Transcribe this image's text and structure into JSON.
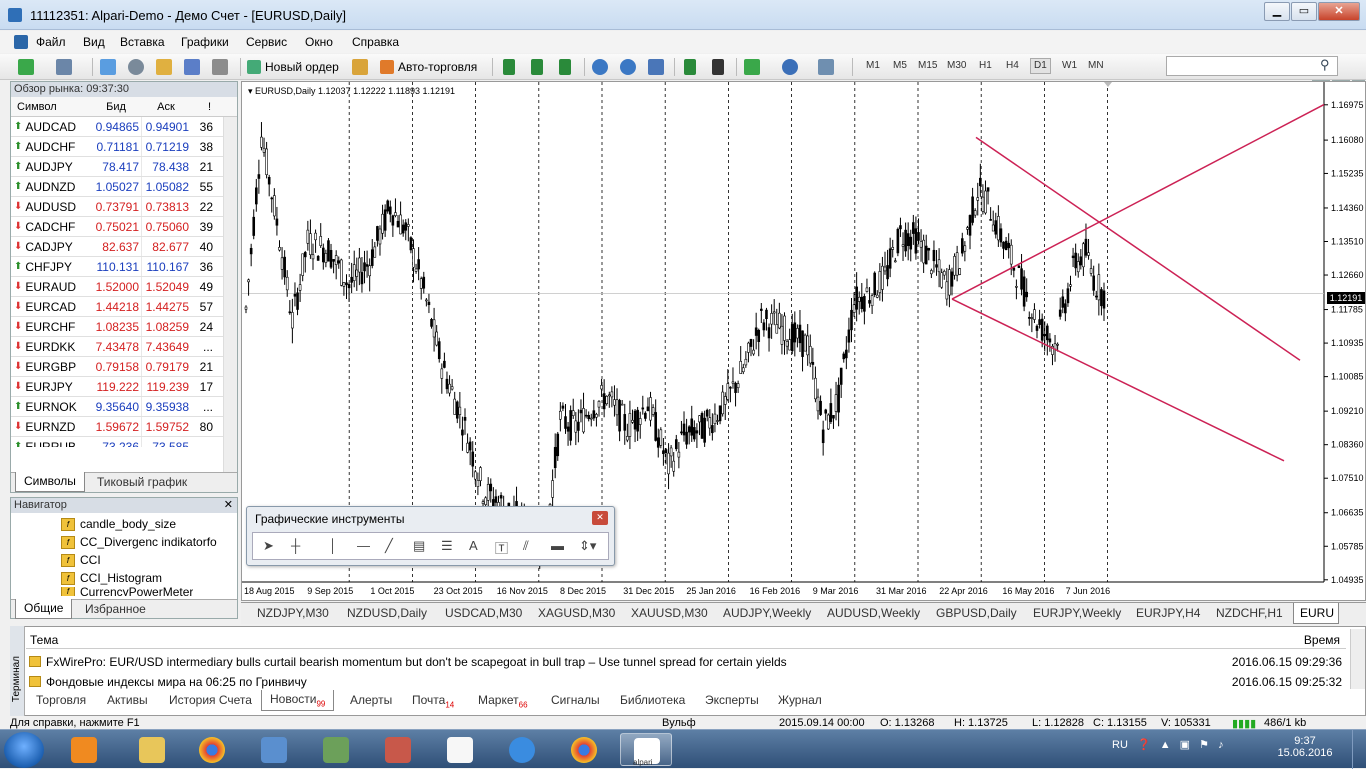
{
  "window": {
    "title": "11112351: Alpari-Demo - Демо Счет - [EURUSD,Daily]"
  },
  "menu": [
    "Файл",
    "Вид",
    "Вставка",
    "Графики",
    "Сервис",
    "Окно",
    "Справка"
  ],
  "toolbar": {
    "new_order": "Новый ордер",
    "autotrading": "Авто-торговля",
    "timeframes": [
      "M1",
      "M5",
      "M15",
      "M30",
      "H1",
      "H4",
      "D1",
      "W1",
      "MN"
    ],
    "active_timeframe": "D1"
  },
  "market_watch": {
    "header": "Обзор рынка: 09:37:30",
    "columns": [
      "Символ",
      "Бид",
      "Аск",
      "!"
    ],
    "rows": [
      {
        "symbol": "AUDCAD",
        "bid": "0.94865",
        "ask": "0.94901",
        "spread": "36",
        "dir": "up"
      },
      {
        "symbol": "AUDCHF",
        "bid": "0.71181",
        "ask": "0.71219",
        "spread": "38",
        "dir": "up"
      },
      {
        "symbol": "AUDJPY",
        "bid": "78.417",
        "ask": "78.438",
        "spread": "21",
        "dir": "up"
      },
      {
        "symbol": "AUDNZD",
        "bid": "1.05027",
        "ask": "1.05082",
        "spread": "55",
        "dir": "up"
      },
      {
        "symbol": "AUDUSD",
        "bid": "0.73791",
        "ask": "0.73813",
        "spread": "22",
        "dir": "down"
      },
      {
        "symbol": "CADCHF",
        "bid": "0.75021",
        "ask": "0.75060",
        "spread": "39",
        "dir": "down"
      },
      {
        "symbol": "CADJPY",
        "bid": "82.637",
        "ask": "82.677",
        "spread": "40",
        "dir": "down"
      },
      {
        "symbol": "CHFJPY",
        "bid": "110.131",
        "ask": "110.167",
        "spread": "36",
        "dir": "up"
      },
      {
        "symbol": "EURAUD",
        "bid": "1.52000",
        "ask": "1.52049",
        "spread": "49",
        "dir": "down"
      },
      {
        "symbol": "EURCAD",
        "bid": "1.44218",
        "ask": "1.44275",
        "spread": "57",
        "dir": "down"
      },
      {
        "symbol": "EURCHF",
        "bid": "1.08235",
        "ask": "1.08259",
        "spread": "24",
        "dir": "down"
      },
      {
        "symbol": "EURDKK",
        "bid": "7.43478",
        "ask": "7.43649",
        "spread": "...",
        "dir": "down"
      },
      {
        "symbol": "EURGBP",
        "bid": "0.79158",
        "ask": "0.79179",
        "spread": "21",
        "dir": "down"
      },
      {
        "symbol": "EURJPY",
        "bid": "119.222",
        "ask": "119.239",
        "spread": "17",
        "dir": "down"
      },
      {
        "symbol": "EURNOK",
        "bid": "9.35640",
        "ask": "9.35938",
        "spread": "...",
        "dir": "up"
      },
      {
        "symbol": "EURNZD",
        "bid": "1.59672",
        "ask": "1.59752",
        "spread": "80",
        "dir": "down"
      },
      {
        "symbol": "EURRUB",
        "bid": "73.236",
        "ask": "73.585",
        "spread": "...",
        "dir": "up"
      }
    ],
    "tabs": [
      "Символы",
      "Тиковый график"
    ]
  },
  "navigator": {
    "header": "Навигатор",
    "items": [
      "candle_body_size",
      "CC_Divergenc indikatorfo",
      "CCI",
      "CCI_Histogram",
      "CurrencyPowerMeter"
    ],
    "tabs": [
      "Общие",
      "Избранное"
    ]
  },
  "chart": {
    "info": "EURUSD,Daily  1.12037 1.12222 1.11893 1.12191",
    "current_price": "1.12191"
  },
  "chart_data": {
    "type": "candlestick",
    "symbol": "EURUSD",
    "timeframe": "Daily",
    "ohlc_last": [
      1.12037,
      1.12222,
      1.11893,
      1.12191
    ],
    "y_ticks": [
      "1.16975",
      "1.16080",
      "1.15235",
      "1.14360",
      "1.13510",
      "1.12660",
      "1.11785",
      "1.10935",
      "1.10085",
      "1.09210",
      "1.08360",
      "1.07510",
      "1.06635",
      "1.05785",
      "1.04935"
    ],
    "x_ticks": [
      "18 Aug 2015",
      "9 Sep 2015",
      "1 Oct 2015",
      "23 Oct 2015",
      "16 Nov 2015",
      "8 Dec 2015",
      "31 Dec 2015",
      "25 Jan 2016",
      "16 Feb 2016",
      "9 Mar 2016",
      "31 Mar 2016",
      "22 Apr 2016",
      "16 May 2016",
      "7 Jun 2016"
    ],
    "ylim": [
      1.0493,
      1.1735
    ]
  },
  "chart_tabs": [
    "NZDJPY,M30",
    "NZDUSD,Daily",
    "USDCAD,M30",
    "XAGUSD,M30",
    "XAUUSD,M30",
    "AUDJPY,Weekly",
    "AUDUSD,Weekly",
    "GBPUSD,Daily",
    "EURJPY,Weekly",
    "EURJPY,H4",
    "NZDCHF,H1",
    "EURU"
  ],
  "graphic_tools": {
    "title": "Графические инструменты"
  },
  "terminal": {
    "side_label": "Терминал",
    "columns": [
      "Тема",
      "Время"
    ],
    "rows": [
      {
        "subject": "FxWirePro: EUR/USD intermediary bulls curtail bearish momentum but don't be scapegoat in bull trap – Use tunnel spread for certain yields",
        "time": "2016.06.15 09:29:36"
      },
      {
        "subject": "Фондовые индексы мира на 06:25 по Гринвичу",
        "time": "2016.06.15 09:25:32"
      }
    ],
    "tabs": [
      {
        "label": "Торговля",
        "badge": ""
      },
      {
        "label": "Активы",
        "badge": ""
      },
      {
        "label": "История Счета",
        "badge": ""
      },
      {
        "label": "Новости",
        "badge": "99"
      },
      {
        "label": "Алерты",
        "badge": ""
      },
      {
        "label": "Почта",
        "badge": "14"
      },
      {
        "label": "Маркет",
        "badge": "66"
      },
      {
        "label": "Сигналы",
        "badge": ""
      },
      {
        "label": "Библиотека",
        "badge": ""
      },
      {
        "label": "Эксперты",
        "badge": ""
      },
      {
        "label": "Журнал",
        "badge": ""
      }
    ]
  },
  "status": {
    "help": "Для справки, нажмите F1",
    "profile": "Вульф",
    "datetime": "2015.09.14 00:00",
    "open": "O: 1.13268",
    "high": "H: 1.13725",
    "low": "L: 1.12828",
    "close": "C: 1.13155",
    "volume": "V: 105331",
    "traffic": "486/1 kb"
  },
  "taskbar": {
    "lang": "RU",
    "time": "9:37",
    "date": "15.06.2016",
    "alpari": "alpari"
  },
  "colors": {
    "bull": "#000000",
    "bear": "#000000",
    "triangle": "#cc2255",
    "accent": "#1a3ebd"
  }
}
